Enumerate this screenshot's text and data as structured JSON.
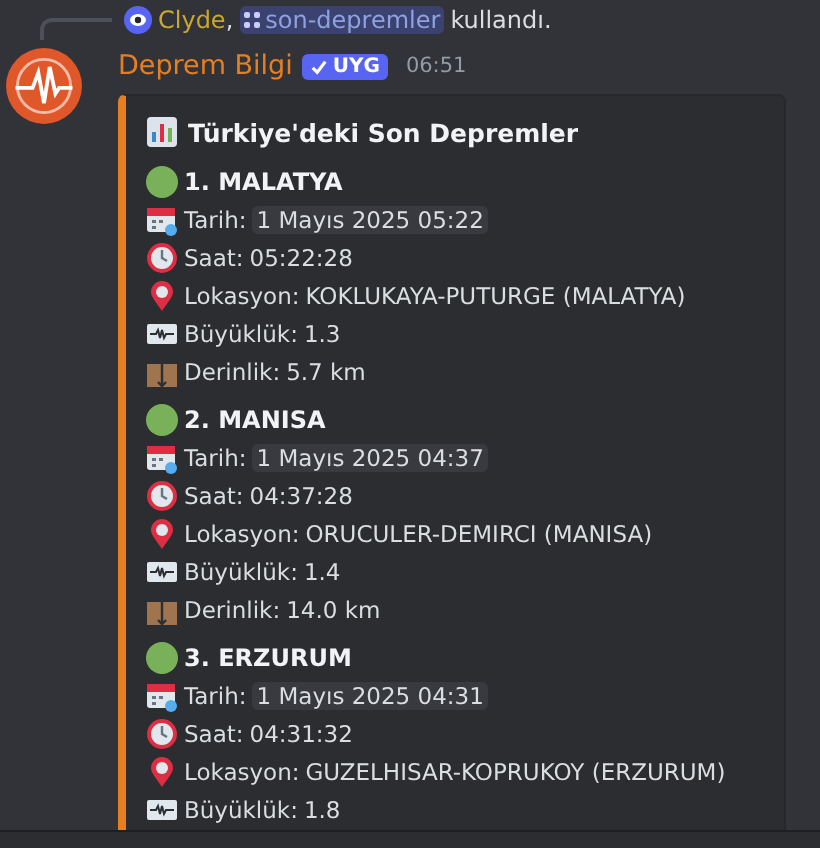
{
  "reply": {
    "user": "Clyde",
    "separator": ",",
    "command": "son-depremler",
    "action": "kullandı."
  },
  "message": {
    "author": "Deprem Bilgi",
    "badge": "UYG",
    "time": "06:51"
  },
  "embed": {
    "title": "Türkiye'deki Son Depremler",
    "quakes": [
      {
        "heading": "1. MALATYA",
        "fields": [
          {
            "kind": "date",
            "label": "Tarih:",
            "value": "1 Mayıs 2025 05:22"
          },
          {
            "kind": "time",
            "label": "Saat:",
            "value": "05:22:28"
          },
          {
            "kind": "location",
            "label": "Lokasyon:",
            "value": "KOKLUKAYA-PUTURGE (MALATYA)"
          },
          {
            "kind": "magnitude",
            "label": "Büyüklük:",
            "value": "1.3"
          },
          {
            "kind": "depth",
            "label": "Derinlik:",
            "value": "5.7 km"
          }
        ]
      },
      {
        "heading": "2. MANISA",
        "fields": [
          {
            "kind": "date",
            "label": "Tarih:",
            "value": "1 Mayıs 2025 04:37"
          },
          {
            "kind": "time",
            "label": "Saat:",
            "value": "04:37:28"
          },
          {
            "kind": "location",
            "label": "Lokasyon:",
            "value": "ORUCULER-DEMIRCI (MANISA)"
          },
          {
            "kind": "magnitude",
            "label": "Büyüklük:",
            "value": "1.4"
          },
          {
            "kind": "depth",
            "label": "Derinlik:",
            "value": "14.0 km"
          }
        ]
      },
      {
        "heading": "3. ERZURUM",
        "fields": [
          {
            "kind": "date",
            "label": "Tarih:",
            "value": "1 Mayıs 2025 04:31"
          },
          {
            "kind": "time",
            "label": "Saat:",
            "value": "04:31:32"
          },
          {
            "kind": "location",
            "label": "Lokasyon:",
            "value": "GUZELHISAR-KOPRUKOY (ERZURUM)"
          },
          {
            "kind": "magnitude",
            "label": "Büyüklük:",
            "value": "1.8"
          }
        ]
      }
    ]
  }
}
